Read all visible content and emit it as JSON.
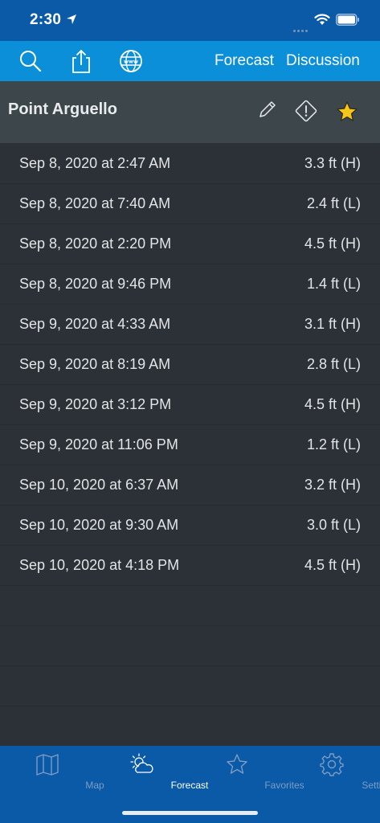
{
  "status_bar": {
    "time": "2:30"
  },
  "toolbar": {
    "forecast_label": "Forecast",
    "discussion_label": "Discussion"
  },
  "station": {
    "name": "Point Arguello"
  },
  "tides": [
    {
      "datetime": "Sep 8, 2020 at 2:47 AM",
      "height": "3.3 ft (H)"
    },
    {
      "datetime": "Sep 8, 2020 at 7:40 AM",
      "height": "2.4 ft (L)"
    },
    {
      "datetime": "Sep 8, 2020 at 2:20 PM",
      "height": "4.5 ft (H)"
    },
    {
      "datetime": "Sep 8, 2020 at 9:46 PM",
      "height": "1.4 ft (L)"
    },
    {
      "datetime": "Sep 9, 2020 at 4:33 AM",
      "height": "3.1 ft (H)"
    },
    {
      "datetime": "Sep 9, 2020 at 8:19 AM",
      "height": "2.8 ft (L)"
    },
    {
      "datetime": "Sep 9, 2020 at 3:12 PM",
      "height": "4.5 ft (H)"
    },
    {
      "datetime": "Sep 9, 2020 at 11:06 PM",
      "height": "1.2 ft (L)"
    },
    {
      "datetime": "Sep 10, 2020 at 6:37 AM",
      "height": "3.2 ft (H)"
    },
    {
      "datetime": "Sep 10, 2020 at 9:30 AM",
      "height": "3.0 ft (L)"
    },
    {
      "datetime": "Sep 10, 2020 at 4:18 PM",
      "height": "4.5 ft (H)"
    }
  ],
  "tabbar": {
    "items": [
      {
        "label": "Map",
        "icon": "map-icon"
      },
      {
        "label": "Forecast",
        "icon": "forecast-icon",
        "active": true
      },
      {
        "label": "Favorites",
        "icon": "star-icon"
      },
      {
        "label": "Settings",
        "icon": "gear-icon"
      }
    ]
  },
  "colors": {
    "status_bar": "#0a5aa8",
    "toolbar": "#0a8fd8",
    "header": "#3c464b",
    "list_bg": "#2b3136",
    "favorite_star": "#f5c518",
    "tab_inactive": "#7e9cc3"
  }
}
